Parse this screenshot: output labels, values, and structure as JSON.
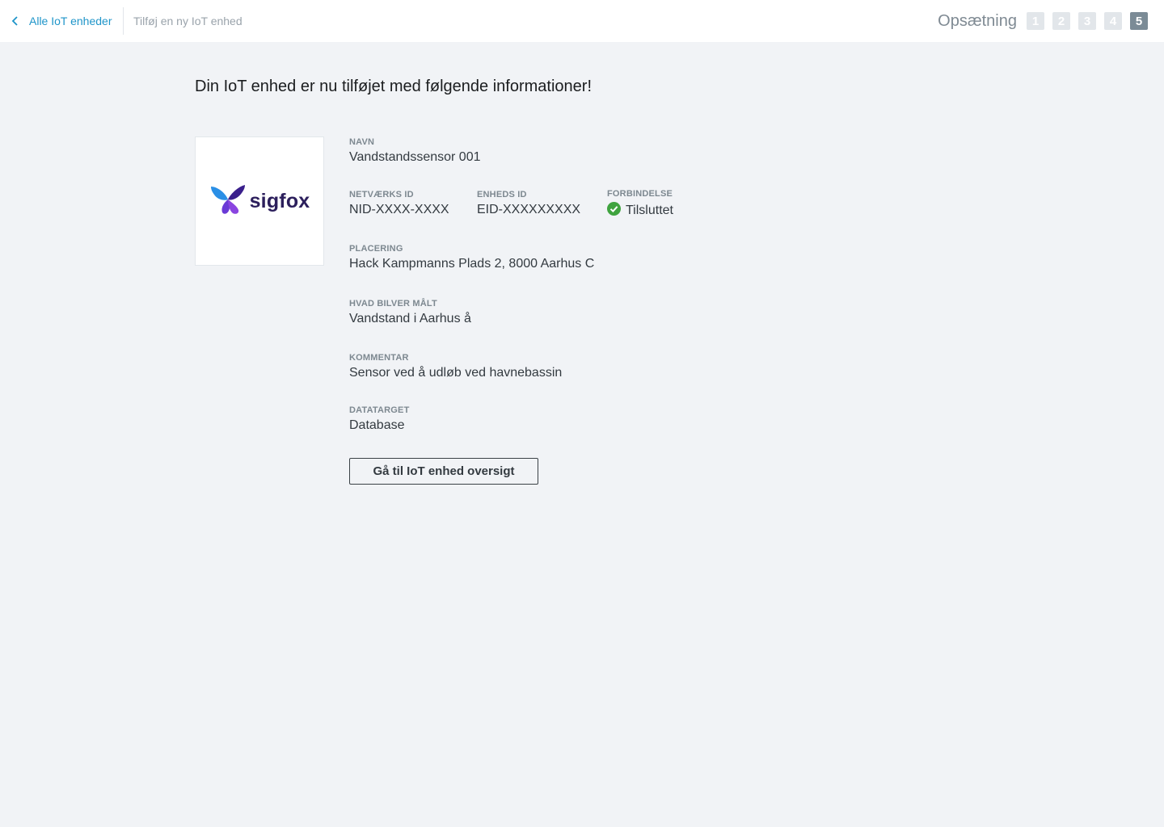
{
  "header": {
    "back_label": "Alle IoT enheder",
    "current_page": "Tilføj en ny IoT enhed",
    "setup_label": "Opsætning",
    "steps": [
      "1",
      "2",
      "3",
      "4",
      "5"
    ],
    "active_step": "5"
  },
  "main": {
    "heading": "Din IoT enhed er nu tilføjet med følgende informationer!",
    "logo_text": "sigfox",
    "fields": {
      "name": {
        "label": "NAVN",
        "value": "Vandstandssensor 001"
      },
      "network_id": {
        "label": "NETVÆRKS ID",
        "value": "NID-XXXX-XXXX"
      },
      "device_id": {
        "label": "ENHEDS ID",
        "value": "EID-XXXXXXXXX"
      },
      "connection": {
        "label": "FORBINDELSE",
        "value": "Tilsluttet",
        "icon": "check-circle-icon",
        "color": "#3fa33f"
      },
      "location": {
        "label": "PLACERING",
        "value": "Hack Kampmanns Plads 2, 8000 Aarhus C"
      },
      "measures": {
        "label": "HVAD BILVER MÅLT",
        "value": "Vandstand i Aarhus å"
      },
      "comment": {
        "label": "KOMMENTAR",
        "value": "Sensor ved å udløb ved havnebassin"
      },
      "datatarget": {
        "label": "DATATARGET",
        "value": "Database"
      }
    },
    "button_label": "Gå til IoT enhed oversigt"
  },
  "colors": {
    "accent_link": "#1f95c9",
    "background": "#f1f3f6",
    "step_active": "#7b8b96",
    "step_inactive": "#e2e6ea",
    "status_ok": "#3fa33f"
  }
}
